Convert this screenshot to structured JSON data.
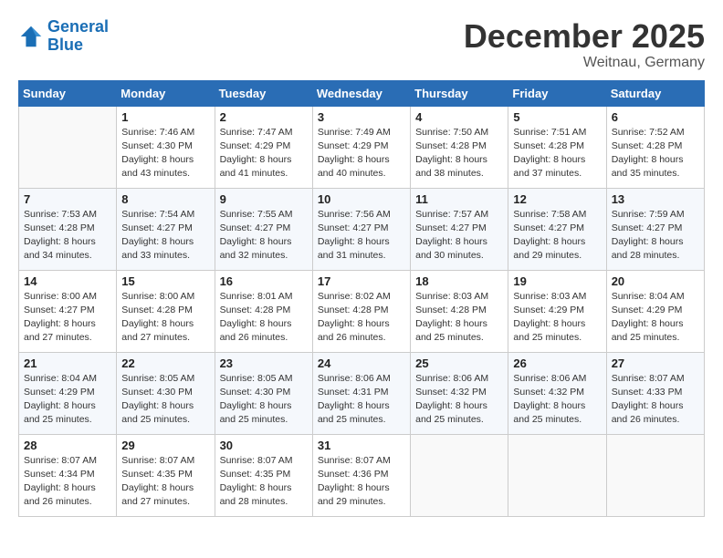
{
  "header": {
    "logo_line1": "General",
    "logo_line2": "Blue",
    "month": "December 2025",
    "location": "Weitnau, Germany"
  },
  "weekdays": [
    "Sunday",
    "Monday",
    "Tuesday",
    "Wednesday",
    "Thursday",
    "Friday",
    "Saturday"
  ],
  "weeks": [
    [
      {
        "day": "",
        "sunrise": "",
        "sunset": "",
        "daylight": ""
      },
      {
        "day": "1",
        "sunrise": "Sunrise: 7:46 AM",
        "sunset": "Sunset: 4:30 PM",
        "daylight": "Daylight: 8 hours and 43 minutes."
      },
      {
        "day": "2",
        "sunrise": "Sunrise: 7:47 AM",
        "sunset": "Sunset: 4:29 PM",
        "daylight": "Daylight: 8 hours and 41 minutes."
      },
      {
        "day": "3",
        "sunrise": "Sunrise: 7:49 AM",
        "sunset": "Sunset: 4:29 PM",
        "daylight": "Daylight: 8 hours and 40 minutes."
      },
      {
        "day": "4",
        "sunrise": "Sunrise: 7:50 AM",
        "sunset": "Sunset: 4:28 PM",
        "daylight": "Daylight: 8 hours and 38 minutes."
      },
      {
        "day": "5",
        "sunrise": "Sunrise: 7:51 AM",
        "sunset": "Sunset: 4:28 PM",
        "daylight": "Daylight: 8 hours and 37 minutes."
      },
      {
        "day": "6",
        "sunrise": "Sunrise: 7:52 AM",
        "sunset": "Sunset: 4:28 PM",
        "daylight": "Daylight: 8 hours and 35 minutes."
      }
    ],
    [
      {
        "day": "7",
        "sunrise": "Sunrise: 7:53 AM",
        "sunset": "Sunset: 4:28 PM",
        "daylight": "Daylight: 8 hours and 34 minutes."
      },
      {
        "day": "8",
        "sunrise": "Sunrise: 7:54 AM",
        "sunset": "Sunset: 4:27 PM",
        "daylight": "Daylight: 8 hours and 33 minutes."
      },
      {
        "day": "9",
        "sunrise": "Sunrise: 7:55 AM",
        "sunset": "Sunset: 4:27 PM",
        "daylight": "Daylight: 8 hours and 32 minutes."
      },
      {
        "day": "10",
        "sunrise": "Sunrise: 7:56 AM",
        "sunset": "Sunset: 4:27 PM",
        "daylight": "Daylight: 8 hours and 31 minutes."
      },
      {
        "day": "11",
        "sunrise": "Sunrise: 7:57 AM",
        "sunset": "Sunset: 4:27 PM",
        "daylight": "Daylight: 8 hours and 30 minutes."
      },
      {
        "day": "12",
        "sunrise": "Sunrise: 7:58 AM",
        "sunset": "Sunset: 4:27 PM",
        "daylight": "Daylight: 8 hours and 29 minutes."
      },
      {
        "day": "13",
        "sunrise": "Sunrise: 7:59 AM",
        "sunset": "Sunset: 4:27 PM",
        "daylight": "Daylight: 8 hours and 28 minutes."
      }
    ],
    [
      {
        "day": "14",
        "sunrise": "Sunrise: 8:00 AM",
        "sunset": "Sunset: 4:27 PM",
        "daylight": "Daylight: 8 hours and 27 minutes."
      },
      {
        "day": "15",
        "sunrise": "Sunrise: 8:00 AM",
        "sunset": "Sunset: 4:28 PM",
        "daylight": "Daylight: 8 hours and 27 minutes."
      },
      {
        "day": "16",
        "sunrise": "Sunrise: 8:01 AM",
        "sunset": "Sunset: 4:28 PM",
        "daylight": "Daylight: 8 hours and 26 minutes."
      },
      {
        "day": "17",
        "sunrise": "Sunrise: 8:02 AM",
        "sunset": "Sunset: 4:28 PM",
        "daylight": "Daylight: 8 hours and 26 minutes."
      },
      {
        "day": "18",
        "sunrise": "Sunrise: 8:03 AM",
        "sunset": "Sunset: 4:28 PM",
        "daylight": "Daylight: 8 hours and 25 minutes."
      },
      {
        "day": "19",
        "sunrise": "Sunrise: 8:03 AM",
        "sunset": "Sunset: 4:29 PM",
        "daylight": "Daylight: 8 hours and 25 minutes."
      },
      {
        "day": "20",
        "sunrise": "Sunrise: 8:04 AM",
        "sunset": "Sunset: 4:29 PM",
        "daylight": "Daylight: 8 hours and 25 minutes."
      }
    ],
    [
      {
        "day": "21",
        "sunrise": "Sunrise: 8:04 AM",
        "sunset": "Sunset: 4:29 PM",
        "daylight": "Daylight: 8 hours and 25 minutes."
      },
      {
        "day": "22",
        "sunrise": "Sunrise: 8:05 AM",
        "sunset": "Sunset: 4:30 PM",
        "daylight": "Daylight: 8 hours and 25 minutes."
      },
      {
        "day": "23",
        "sunrise": "Sunrise: 8:05 AM",
        "sunset": "Sunset: 4:30 PM",
        "daylight": "Daylight: 8 hours and 25 minutes."
      },
      {
        "day": "24",
        "sunrise": "Sunrise: 8:06 AM",
        "sunset": "Sunset: 4:31 PM",
        "daylight": "Daylight: 8 hours and 25 minutes."
      },
      {
        "day": "25",
        "sunrise": "Sunrise: 8:06 AM",
        "sunset": "Sunset: 4:32 PM",
        "daylight": "Daylight: 8 hours and 25 minutes."
      },
      {
        "day": "26",
        "sunrise": "Sunrise: 8:06 AM",
        "sunset": "Sunset: 4:32 PM",
        "daylight": "Daylight: 8 hours and 25 minutes."
      },
      {
        "day": "27",
        "sunrise": "Sunrise: 8:07 AM",
        "sunset": "Sunset: 4:33 PM",
        "daylight": "Daylight: 8 hours and 26 minutes."
      }
    ],
    [
      {
        "day": "28",
        "sunrise": "Sunrise: 8:07 AM",
        "sunset": "Sunset: 4:34 PM",
        "daylight": "Daylight: 8 hours and 26 minutes."
      },
      {
        "day": "29",
        "sunrise": "Sunrise: 8:07 AM",
        "sunset": "Sunset: 4:35 PM",
        "daylight": "Daylight: 8 hours and 27 minutes."
      },
      {
        "day": "30",
        "sunrise": "Sunrise: 8:07 AM",
        "sunset": "Sunset: 4:35 PM",
        "daylight": "Daylight: 8 hours and 28 minutes."
      },
      {
        "day": "31",
        "sunrise": "Sunrise: 8:07 AM",
        "sunset": "Sunset: 4:36 PM",
        "daylight": "Daylight: 8 hours and 29 minutes."
      },
      {
        "day": "",
        "sunrise": "",
        "sunset": "",
        "daylight": ""
      },
      {
        "day": "",
        "sunrise": "",
        "sunset": "",
        "daylight": ""
      },
      {
        "day": "",
        "sunrise": "",
        "sunset": "",
        "daylight": ""
      }
    ]
  ]
}
